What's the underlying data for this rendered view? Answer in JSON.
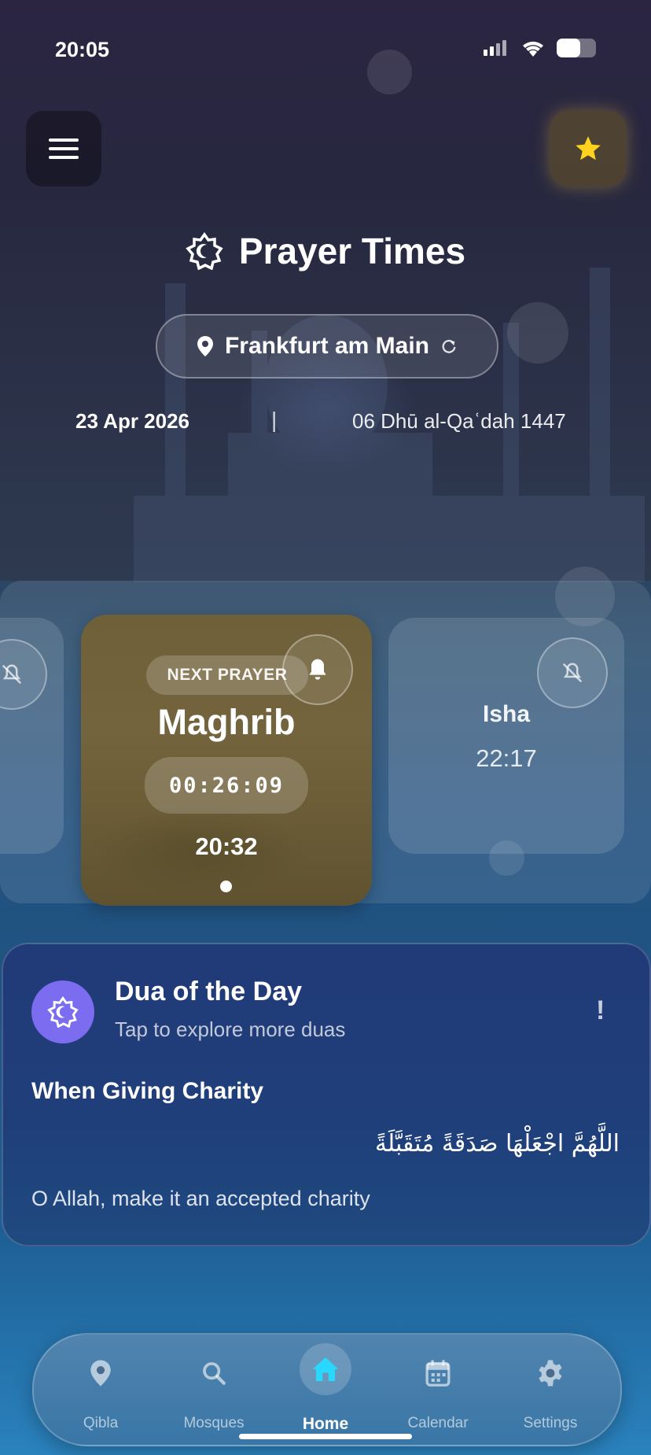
{
  "status_bar": {
    "time": "20:05",
    "battery_level": 0.6
  },
  "header": {
    "title": "Prayer Times",
    "location": "Frankfurt am Main",
    "gregorian_date": "23 Apr 2026",
    "separator": "|",
    "hijri_date": "06 Dhū al-Qaʿdah 1447"
  },
  "prayers": {
    "next_label": "NEXT PRAYER",
    "current": {
      "name": "Maghrib",
      "countdown": "00:26:09",
      "time": "20:32",
      "notification": "on"
    },
    "next": {
      "name": "Isha",
      "time": "22:17",
      "notification": "off"
    },
    "previous": {
      "notification": "off"
    }
  },
  "dua": {
    "title": "Dua of the Day",
    "subtitle": "Tap to explore more duas",
    "info_symbol": "!",
    "heading": "When Giving Charity",
    "arabic": "اللَّهُمَّ اجْعَلْهَا صَدَقَةً مُتَقَبَّلَةً",
    "translation": "O Allah, make it an accepted charity"
  },
  "nav": {
    "items": [
      {
        "label": "Qibla",
        "icon": "location-pin-icon"
      },
      {
        "label": "Mosques",
        "icon": "search-icon"
      },
      {
        "label": "Home",
        "icon": "home-icon",
        "active": true
      },
      {
        "label": "Calendar",
        "icon": "calendar-icon"
      },
      {
        "label": "Settings",
        "icon": "gear-icon"
      }
    ]
  },
  "colors": {
    "accent_star": "#FFD21F",
    "home_active": "#28D8FF",
    "dua_icon_bg": "#7B6CF0"
  }
}
